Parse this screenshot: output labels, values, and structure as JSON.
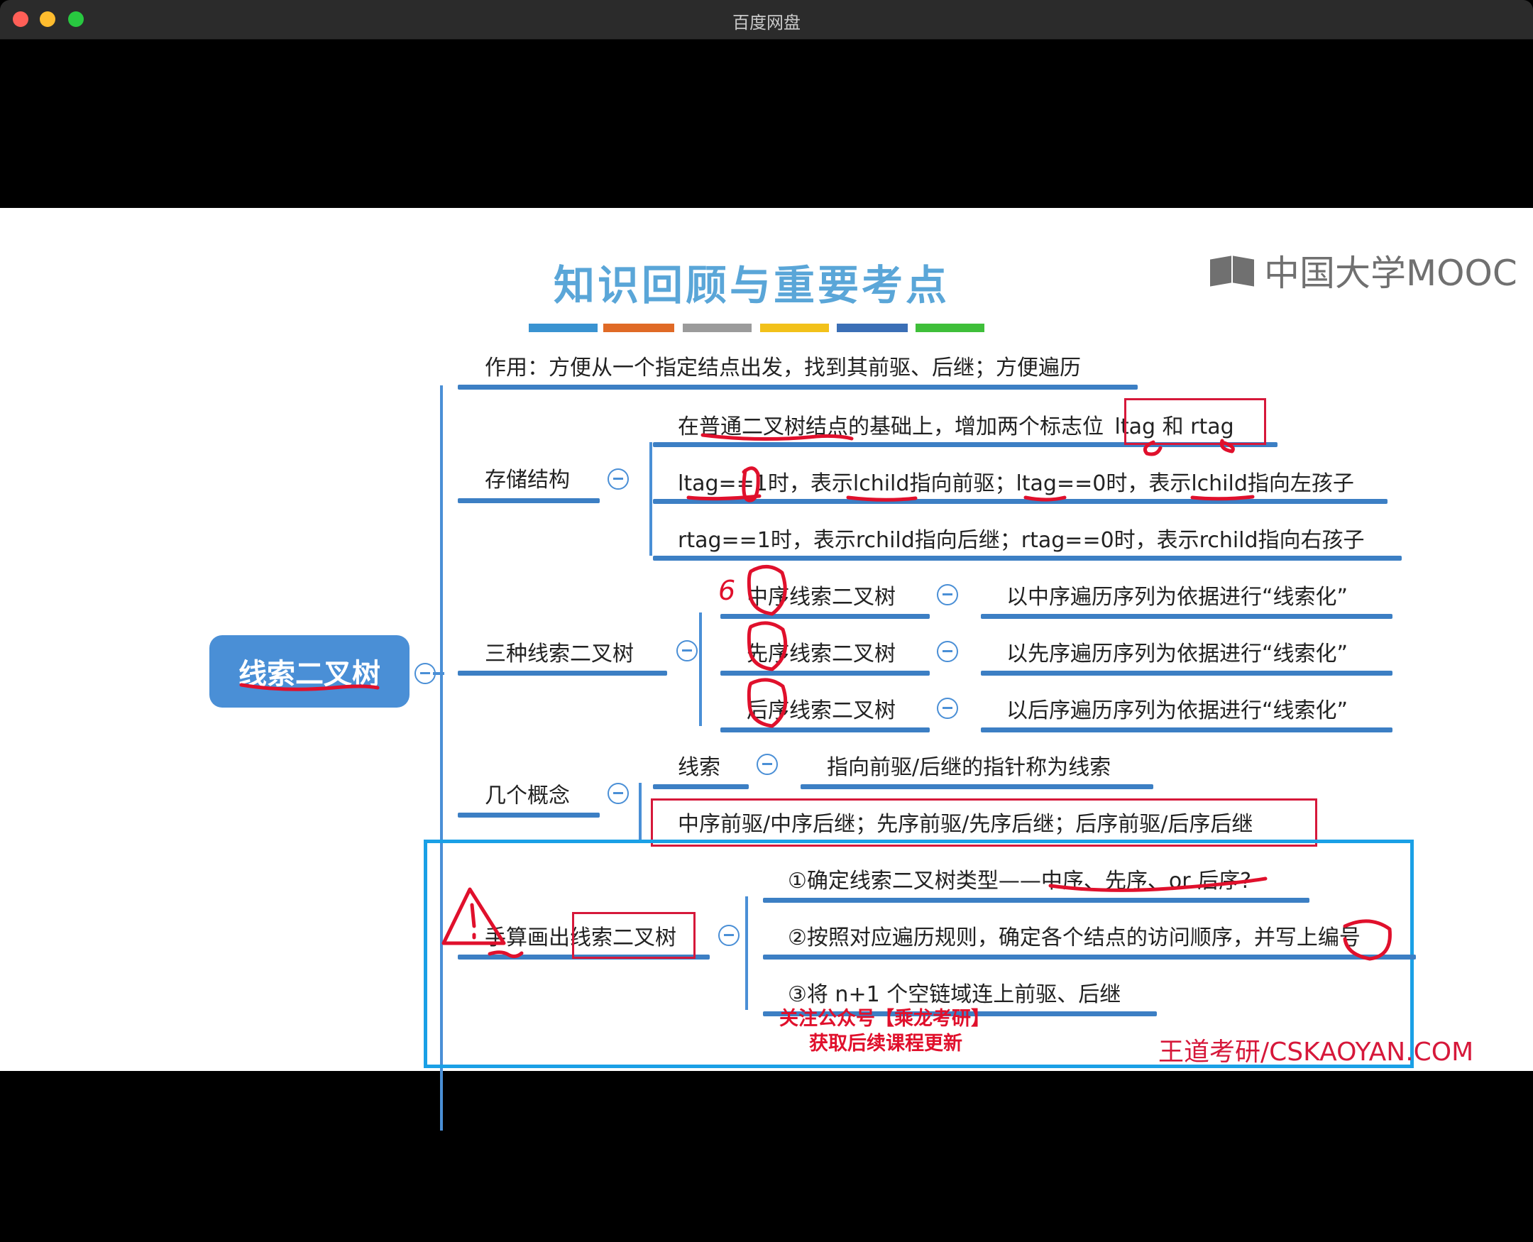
{
  "window": {
    "title": "百度网盘"
  },
  "slide": {
    "title": "知识回顾与重要考点",
    "logo": "中国大学MOOC",
    "strip_colors": [
      "#3a93d1",
      "#e06a26",
      "#9b9b9b",
      "#f2c11a",
      "#3b6fb6",
      "#3fbf3a"
    ],
    "root": "线索二叉树",
    "purpose": "作用：方便从一个指定结点出发，找到其前驱、后继；方便遍历",
    "storage": {
      "label": "存储结构",
      "line1_prefix": "在普通二叉树结点的基础上，增加两个标志位",
      "line1_tags": "ltag 和 rtag",
      "line2": "ltag==1时，表示lchild指向前驱；ltag==0时，表示lchild指向左孩子",
      "line3": "rtag==1时，表示rchild指向后继；rtag==0时，表示rchild指向右孩子"
    },
    "three_types": {
      "label": "三种线索二叉树",
      "items": [
        {
          "name": "中序线索二叉树",
          "desc": "以中序遍历序列为依据进行“线索化”"
        },
        {
          "name": "先序线索二叉树",
          "desc": "以先序遍历序列为依据进行“线索化”"
        },
        {
          "name": "后序线索二叉树",
          "desc": "以后序遍历序列为依据进行“线索化”"
        }
      ]
    },
    "concepts": {
      "label": "几个概念",
      "thread": "线索",
      "thread_desc": "指向前驱/后继的指针称为线索",
      "pairs": "中序前驱/中序后继；先序前驱/先序后继；后序前驱/后序后继"
    },
    "manual": {
      "label": "手算画出线索二叉树",
      "steps": [
        "①确定线索二叉树类型——中序、先序、or 后序?",
        "②按照对应遍历规则，确定各个结点的访问顺序，并写上编号",
        "③将 n+1 个空链域连上前驱、后继"
      ]
    },
    "promo_line1": "关注公众号【乘龙考研】",
    "promo_line2": "获取后续课程更新",
    "brand": "王道考研/CSKAOYAN.COM",
    "handwritten_six": "6"
  }
}
